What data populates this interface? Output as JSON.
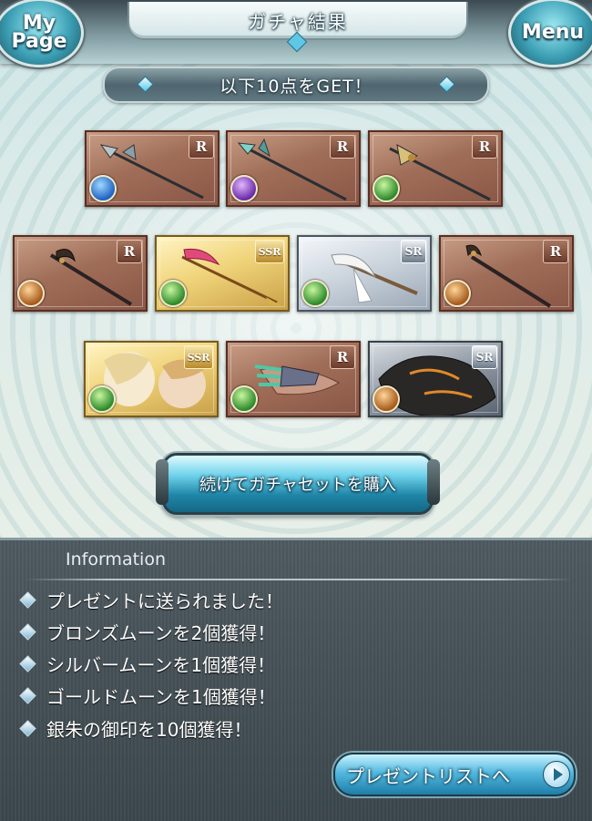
{
  "header": {
    "title": "ガチャ結果",
    "mypage_label_line1": "My",
    "mypage_label_line2": "Page",
    "menu_label": "Menu"
  },
  "get_banner": {
    "text": "以下10点をGET！"
  },
  "items": [
    {
      "rarity": "R",
      "element": "water",
      "kind": "polearm"
    },
    {
      "rarity": "R",
      "element": "dark",
      "kind": "polearm"
    },
    {
      "rarity": "R",
      "element": "wind",
      "kind": "polearm"
    },
    {
      "rarity": "R",
      "element": "earth",
      "kind": "scythe"
    },
    {
      "rarity": "SSR",
      "element": "wind",
      "kind": "spear"
    },
    {
      "rarity": "SR",
      "element": "wind",
      "kind": "scythe"
    },
    {
      "rarity": "R",
      "element": "earth",
      "kind": "staff"
    },
    {
      "rarity": "SSR",
      "element": "wind",
      "kind": "summon"
    },
    {
      "rarity": "R",
      "element": "wind",
      "kind": "claw"
    },
    {
      "rarity": "SR",
      "element": "earth",
      "kind": "summon"
    }
  ],
  "continue_button": {
    "label": "続けてガチャセットを購入"
  },
  "information": {
    "title": "Information",
    "messages": [
      "プレゼントに送られました！",
      "ブロンズムーンを2個獲得！",
      "シルバームーンを1個獲得！",
      "ゴールドムーンを1個獲得！",
      "銀朱の御印を10個獲得！"
    ]
  },
  "present_button": {
    "label": "プレゼントリストへ"
  },
  "colors": {
    "accent": "#53b8de",
    "panel": "#3f4a50",
    "r_card": "#a06e58",
    "ssr_card": "#f0d47a",
    "sr_card": "#c9d2db"
  }
}
